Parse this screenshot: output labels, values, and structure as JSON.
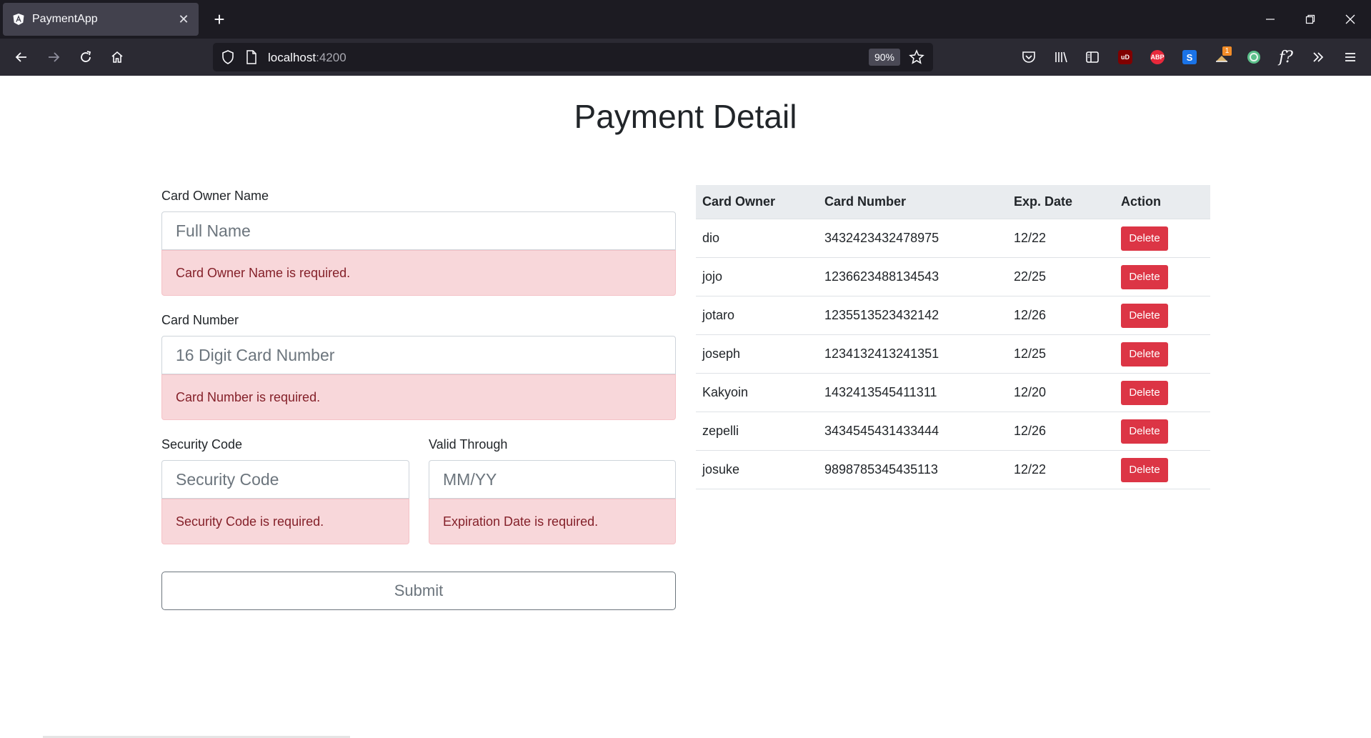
{
  "browser": {
    "tab_title": "PaymentApp",
    "url_host": "localhost",
    "url_port": ":4200",
    "zoom": "90%"
  },
  "page": {
    "title": "Payment Detail"
  },
  "form": {
    "owner": {
      "label": "Card Owner Name",
      "placeholder": "Full Name",
      "error": "Card Owner Name is required."
    },
    "number": {
      "label": "Card Number",
      "placeholder": "16 Digit Card Number",
      "error": "Card Number is required."
    },
    "security": {
      "label": "Security Code",
      "placeholder": "Security Code",
      "error": "Security Code is required."
    },
    "valid": {
      "label": "Valid Through",
      "placeholder": "MM/YY",
      "error": "Expiration Date is required."
    },
    "submit_label": "Submit"
  },
  "table": {
    "headers": [
      "Card Owner",
      "Card Number",
      "Exp. Date",
      "Action"
    ],
    "delete_label": "Delete",
    "rows": [
      {
        "owner": "dio",
        "number": "3432423432478975",
        "exp": "12/22"
      },
      {
        "owner": "jojo",
        "number": "1236623488134543",
        "exp": "22/25"
      },
      {
        "owner": "jotaro",
        "number": "1235513523432142",
        "exp": "12/26"
      },
      {
        "owner": "joseph",
        "number": "1234132413241351",
        "exp": "12/25"
      },
      {
        "owner": "Kakyoin",
        "number": "1432413545411311",
        "exp": "12/20"
      },
      {
        "owner": "zepelli",
        "number": "3434545431433444",
        "exp": "12/26"
      },
      {
        "owner": "josuke",
        "number": "9898785345435113",
        "exp": "12/22"
      }
    ]
  },
  "colors": {
    "danger": "#dc3545",
    "alert_bg": "#f8d7da",
    "alert_text": "#842029",
    "chrome_dark": "#1c1b22"
  },
  "extensions": {
    "ublock": "uD",
    "adblock": "ABP",
    "s_ext": "S",
    "badge_count": "1",
    "fx": "f?"
  }
}
